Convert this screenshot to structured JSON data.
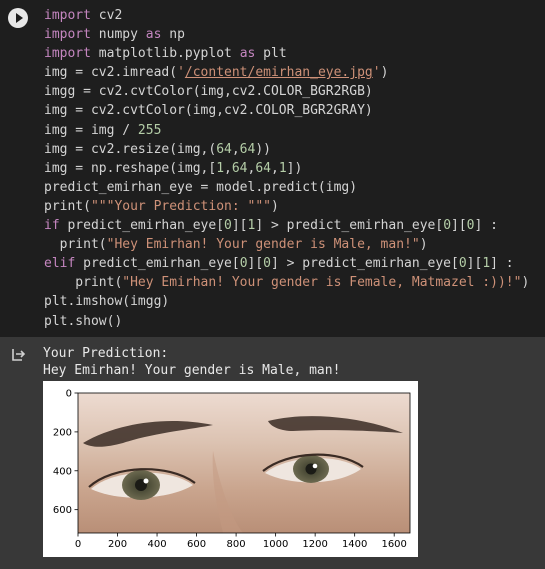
{
  "code_lines": [
    "import cv2",
    "import numpy as np",
    "import matplotlib.pyplot as plt",
    "img = cv2.imread('/content/emirhan_eye.jpg')",
    "imgg = cv2.cvtColor(img,cv2.COLOR_BGR2RGB)",
    "img = cv2.cvtColor(img,cv2.COLOR_BGR2GRAY)",
    "img = img / 255",
    "img = cv2.resize(img,(64,64))",
    "img = np.reshape(img,[1,64,64,1])",
    "predict_emirhan_eye = model.predict(img)",
    "print(\"\"\"Your Prediction: \"\"\")",
    "if predict_emirhan_eye[0][1] > predict_emirhan_eye[0][0] :",
    "  print(\"Hey Emirhan! Your gender is Male, man!\")",
    "elif predict_emirhan_eye[0][0] > predict_emirhan_eye[0][1] :",
    "    print(\"Hey Emirhan! Your gender is Female, Matmazel :))!\")",
    "plt.imshow(imgg)",
    "plt.show()"
  ],
  "output_lines": [
    "Your Prediction:",
    "Hey Emirhan! Your gender is Male, man!"
  ],
  "icons": {
    "run": "play-circle-icon",
    "output": "output-redirect-icon"
  },
  "chart_data": {
    "type": "image",
    "x_ticks": [
      "0",
      "200",
      "400",
      "600",
      "800",
      "1000",
      "1200",
      "1400",
      "1600"
    ],
    "y_ticks": [
      "0",
      "200",
      "400",
      "600"
    ],
    "xlim": [
      0,
      1680
    ],
    "ylim": [
      720,
      0
    ],
    "image_description_free": true
  }
}
